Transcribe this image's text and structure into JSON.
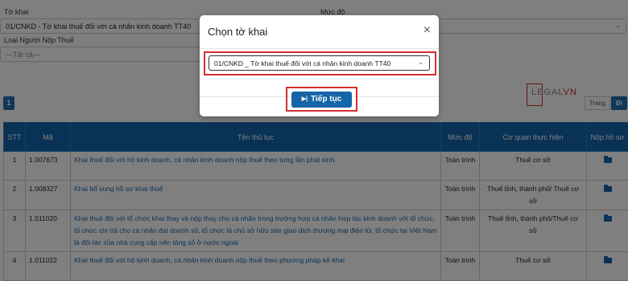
{
  "filters": {
    "to_khai_label": "Tờ khai",
    "to_khai_value": "01/CNKD - Tờ khai thuế đối với cá nhân kinh doanh TT40",
    "muc_do_label": "Mức độ",
    "loai_nnt_label": "Loại Người Nộp Thuế",
    "loai_nnt_value": "---Tất cả---"
  },
  "pagination": {
    "current_page": "1",
    "page_placeholder": "Trang",
    "go_label": "Đi"
  },
  "watermark": {
    "part1": "LEGAL",
    "part2": "VN"
  },
  "table": {
    "headers": [
      "STT",
      "Mã",
      "Tên thủ tục",
      "Mức độ",
      "Cơ quan thực hiện",
      "Nộp hồ sơ"
    ],
    "rows": [
      {
        "stt": "1",
        "ma": "1.007673",
        "ten": "Khai thuế đối với hộ kinh doanh, cá nhân kinh doanh nộp thuế theo từng lần phát sinh.",
        "muc_do": "Toàn trình",
        "co_quan": "Thuế cơ sở"
      },
      {
        "stt": "2",
        "ma": "1.008327",
        "ten": "Khai bổ sung hồ sơ khai thuế",
        "muc_do": "Toàn trình",
        "co_quan": "Thuế tỉnh, thành phố/ Thuế cơ sở"
      },
      {
        "stt": "3",
        "ma": "1.011020",
        "ten": "Khai thuế đối với tổ chức khai thay và nộp thay cho cá nhân trong trường hợp cá nhân hợp tác kinh doanh với tổ chức, tổ chức chi trả cho cá nhân đạt doanh số, tổ chức là chủ sở hữu sàn giao dịch thương mại điện tử, tổ chức tại Việt Nam là đối tác của nhà cung cấp nền tảng số ở nước ngoài",
        "muc_do": "Toàn trình",
        "co_quan": "Thuế tỉnh, thành phố/Thuế cơ sở"
      },
      {
        "stt": "4",
        "ma": "1.011022",
        "ten": "Khai thuế đối với hộ kinh doanh, cá nhân kinh doanh nộp thuế theo phương pháp kê khai",
        "muc_do": "Toàn trình",
        "co_quan": "Thuế cơ sở"
      }
    ]
  },
  "modal": {
    "title": "Chọn tờ khai",
    "close_icon": "×",
    "select_value": "01/CNKD _ Tờ khai thuế đối với cá nhân kinh doanh TT40",
    "button_label": "Tiếp tục",
    "button_icon": "play-icon"
  },
  "colors": {
    "primary": "#1565a8",
    "highlight": "#d32f2f",
    "overlay": "rgba(0,0,0,0.5)"
  }
}
